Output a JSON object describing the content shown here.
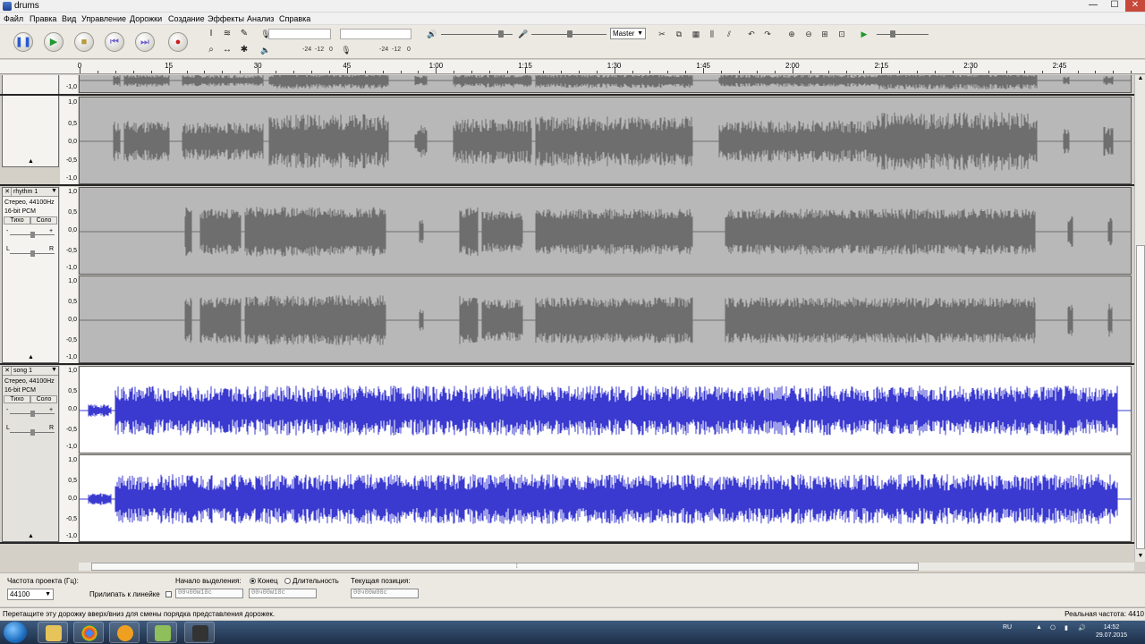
{
  "window": {
    "title": "drums",
    "min": "—",
    "max": "☐",
    "close": "✕"
  },
  "menu": [
    "Файл",
    "Правка",
    "Вид",
    "Управление",
    "Дорожки",
    "Создание",
    "Эффекты",
    "Анализ",
    "Справка"
  ],
  "meters": {
    "rec_scale": [
      "-24",
      "-12",
      "0"
    ],
    "play_scale": [
      "-24",
      "-12",
      "0"
    ],
    "device": "Master"
  },
  "ruler": {
    "labels": [
      "0",
      "15",
      "30",
      "45",
      "1:00",
      "1:15",
      "1:30",
      "1:45",
      "2:00",
      "2:15",
      "2:30",
      "2:45"
    ]
  },
  "tracks": {
    "scale": [
      "1,0",
      "0,5",
      "0,0",
      "-0,5",
      "-1,0"
    ],
    "top_partial_scale": "-1,0",
    "rhythm": {
      "name": "rhythm 1",
      "info1": "Стерео, 44100Hz",
      "info2": "16-bit PCM",
      "mute": "Тихо",
      "solo": "Соло"
    },
    "song": {
      "name": "song 1",
      "info1": "Стерео, 44100Hz",
      "info2": "16-bit PCM",
      "mute": "Тихо",
      "solo": "Соло"
    },
    "gain_minus": "-",
    "gain_plus": "+",
    "pan_l": "L",
    "pan_r": "R",
    "close": "✕",
    "menu": "▼",
    "collapse": "▲"
  },
  "selection_bar": {
    "rate_label": "Частота проекта (Гц):",
    "rate_value": "44100",
    "snap_label": "Прилипать к линейке",
    "start_label": "Начало выделения:",
    "end_label": "Конец",
    "length_label": "Длительность",
    "pos_label": "Текущая позиция:",
    "start_time": "00ч00м10с",
    "end_time": "00ч00м10с",
    "pos_time": "00ч00м00с"
  },
  "status": {
    "message": "Перетащите эту дорожку вверх/вниз для смены порядка представления дорожек.",
    "rate": "Реальная частота: 4410"
  },
  "taskbar": {
    "lang": "RU",
    "time": "14:52",
    "date": "29.07.2015"
  }
}
